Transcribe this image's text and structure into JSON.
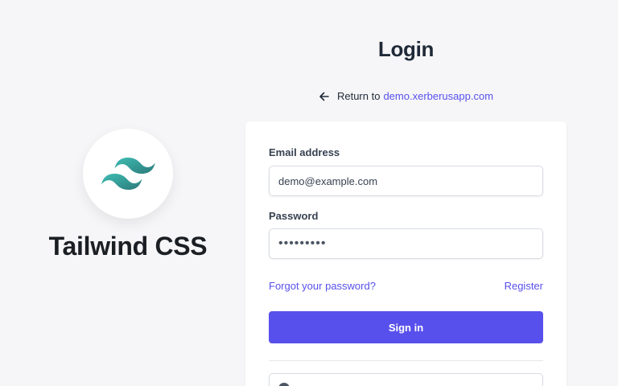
{
  "brand": {
    "name": "Tailwind CSS",
    "logo_icon": "tailwind-logo-icon",
    "logo_colors": [
      "#38b2ac",
      "#2c7a7b"
    ]
  },
  "login": {
    "title": "Login",
    "return_text": "Return to",
    "return_link": "demo.xerberusapp.com",
    "return_icon": "arrow-left-icon"
  },
  "form": {
    "email_label": "Email address",
    "email_value": "demo@example.com",
    "password_label": "Password",
    "password_value": "•••••••••",
    "forgot_link": "Forgot your password?",
    "register_link": "Register",
    "signin_label": "Sign in",
    "social_icon": "github-icon"
  },
  "colors": {
    "accent": "#5850ec",
    "background": "#f6f6f8",
    "card": "#ffffff"
  }
}
